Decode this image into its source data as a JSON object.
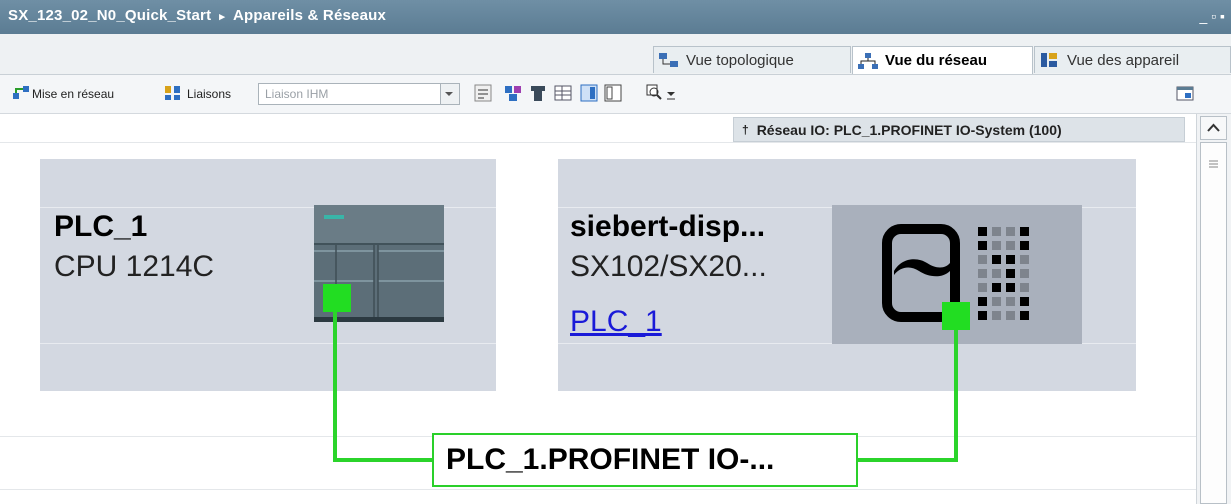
{
  "titlebar": {
    "project": "SX_123_02_N0_Quick_Start",
    "separator": "▸",
    "section": "Appareils & Réseaux",
    "window_buttons": "_ ▫ ▪"
  },
  "tabs": [
    {
      "label": "Vue topologique",
      "icon": "topology-icon"
    },
    {
      "label": "Vue du réseau",
      "icon": "network-view-icon",
      "active": true
    },
    {
      "label": "Vue des appareil",
      "icon": "device-view-icon"
    }
  ],
  "toolbar": {
    "network_label": "Mise en réseau",
    "connections_label": "Liaisons",
    "connection_type_value": "Liaison IHM"
  },
  "network_label": "Réseau IO: PLC_1.PROFINET IO-System (100)",
  "devices": [
    {
      "name": "PLC_1",
      "type": "CPU 1214C"
    },
    {
      "name": "siebert-disp...",
      "type": "SX102/SX20...",
      "link": "PLC_1"
    }
  ],
  "network": {
    "label": "PLC_1.PROFINET  IO-..."
  },
  "colors": {
    "port": "#22dd22",
    "titlebar": "#5b7c93",
    "device_bg": "#d3d8e1"
  }
}
